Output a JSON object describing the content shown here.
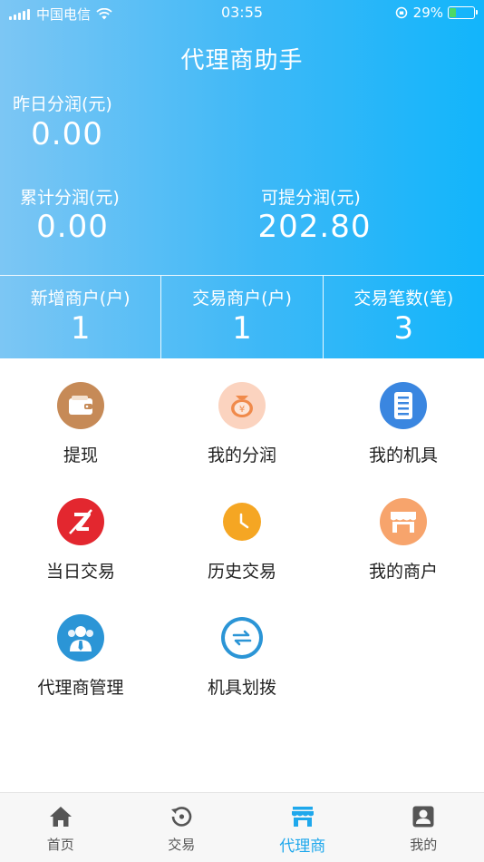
{
  "status_bar": {
    "carrier": "中国电信",
    "time": "03:55",
    "battery": "29%",
    "battery_level": 0.29
  },
  "header": {
    "title": "代理商助手",
    "yesterday_label": "昨日分润(元)",
    "yesterday_value": "0.00",
    "total_label": "累计分润(元)",
    "total_value": "0.00",
    "withdrawable_label": "可提分润(元)",
    "withdrawable_value": "202.80"
  },
  "metrics": [
    {
      "label": "新增商户(户)",
      "value": "1"
    },
    {
      "label": "交易商户(户)",
      "value": "1"
    },
    {
      "label": "交易笔数(笔)",
      "value": "3"
    }
  ],
  "menu": [
    {
      "label": "提现",
      "icon": "wallet-icon",
      "color": "#c68a57"
    },
    {
      "label": "我的分润",
      "icon": "money-bag-icon",
      "color": "#fbd3bf"
    },
    {
      "label": "我的机具",
      "icon": "device-icon",
      "color": "#3a86e0"
    },
    {
      "label": "当日交易",
      "icon": "z-icon",
      "color": "#e3272f"
    },
    {
      "label": "历史交易",
      "icon": "clock-icon",
      "color": "#f5a623"
    },
    {
      "label": "我的商户",
      "icon": "shop-icon",
      "color": "#f7a46c"
    },
    {
      "label": "代理商管理",
      "icon": "agent-icon",
      "color": "#2b95d6"
    },
    {
      "label": "机具划拨",
      "icon": "transfer-icon",
      "color": "#2b95d6"
    }
  ],
  "tabbar": [
    {
      "label": "首页",
      "icon": "home-icon",
      "active": false
    },
    {
      "label": "交易",
      "icon": "history-icon",
      "active": false
    },
    {
      "label": "代理商",
      "icon": "store-icon",
      "active": true
    },
    {
      "label": "我的",
      "icon": "profile-icon",
      "active": false
    }
  ],
  "colors": {
    "accent": "#1fa8ec",
    "header_start": "#7cc6f4",
    "header_end": "#12b5fb"
  }
}
